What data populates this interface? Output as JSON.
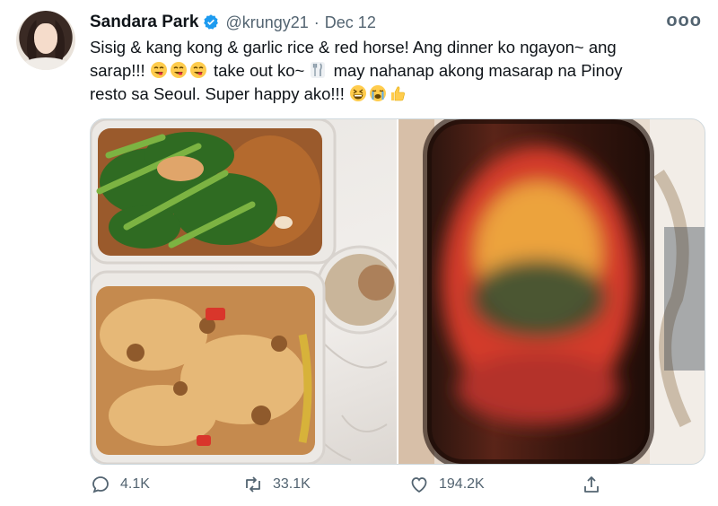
{
  "tweet": {
    "author_name": "Sandara Park",
    "handle": "@krungy21",
    "separator": "·",
    "date": "Dec 12",
    "more": "ooo",
    "text_line1": "Sisig & kang kong & garlic rice & red horse! Ang dinner ko ngayon~ ang",
    "text_line2_a": "sarap!!! ",
    "text_line2_b": " take out ko~ ",
    "text_line2_c": "  may nahanap akong masarap na Pinoy",
    "text_line3": "resto sa Seoul. Super happy ako!!! ",
    "emojis": [
      "yum-face-emoji",
      "yum-face-emoji",
      "yum-face-emoji",
      "fork-and-knife-emoji",
      "grinning-squinting-emoji",
      "loudly-crying-emoji",
      "thumbs-up-emoji"
    ]
  },
  "media": {
    "images": [
      {
        "name": "food-photo",
        "description_visible": false
      },
      {
        "name": "beer-bottle-photo",
        "description_visible": false
      }
    ]
  },
  "actions": {
    "reply_count": "4.1K",
    "retweet_count": "33.1K",
    "like_count": "194.2K"
  },
  "colors": {
    "verified_blue": "#1d9bf0",
    "muted_text": "#536471",
    "text": "#0f1419",
    "border": "#cfd9de"
  }
}
